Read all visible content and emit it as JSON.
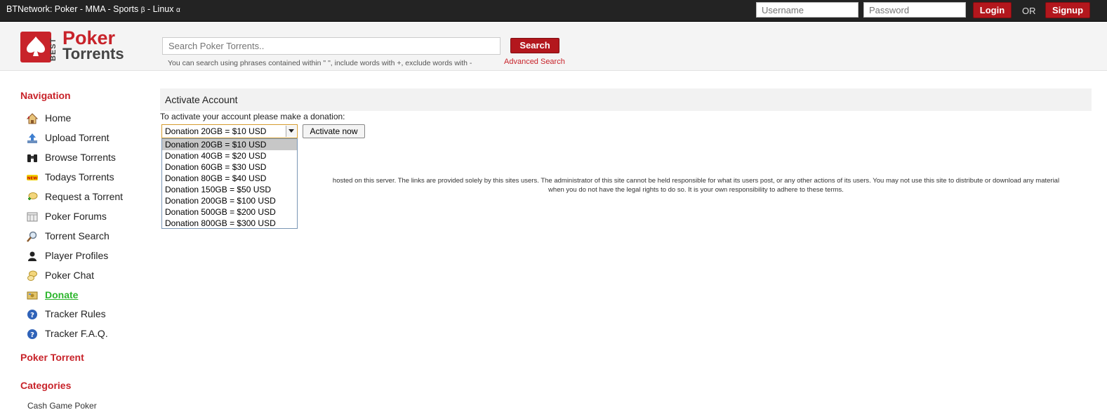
{
  "topbar": {
    "network_prefix": "BTNetwork: Poker - MMA - Sports ",
    "beta_symbol": "β",
    "network_mid": " - Linux ",
    "alpha_symbol": "α",
    "username_placeholder": "Username",
    "password_placeholder": "Password",
    "login_label": "Login",
    "or_label": "OR",
    "signup_label": "Signup"
  },
  "logo": {
    "best": "BEST",
    "poker": "Poker",
    "torrents": "Torrents"
  },
  "search": {
    "placeholder": "Search Poker Torrents..",
    "button_label": "Search",
    "hint": "You can search using phrases contained within \" \", include words with +, exclude words with -",
    "advanced_label": "Advanced Search"
  },
  "sidebar": {
    "nav_heading": "Navigation",
    "items": [
      {
        "label": "Home",
        "icon": "home-icon"
      },
      {
        "label": "Upload Torrent",
        "icon": "upload-icon"
      },
      {
        "label": "Browse Torrents",
        "icon": "binoculars-icon"
      },
      {
        "label": "Todays Torrents",
        "icon": "new-badge-icon"
      },
      {
        "label": "Request a Torrent",
        "icon": "request-icon"
      },
      {
        "label": "Poker Forums",
        "icon": "forum-icon"
      },
      {
        "label": "Torrent Search",
        "icon": "magnifier-icon"
      },
      {
        "label": "Player Profiles",
        "icon": "user-icon"
      },
      {
        "label": "Poker Chat",
        "icon": "chat-icon"
      },
      {
        "label": "Donate",
        "icon": "donate-icon"
      },
      {
        "label": "Tracker Rules",
        "icon": "help-icon"
      },
      {
        "label": "Tracker F.A.Q.",
        "icon": "help-icon"
      }
    ],
    "poker_torrent_heading": "Poker Torrent",
    "categories_heading": "Categories",
    "categories": [
      "Cash Game Poker"
    ]
  },
  "content": {
    "title": "Activate Account",
    "instruction": "To activate your account please make a donation:",
    "selected_value": "Donation 20GB = $10 USD",
    "activate_button": "Activate now",
    "options": [
      "Donation 20GB = $10 USD",
      "Donation 40GB = $20 USD",
      "Donation 60GB = $30 USD",
      "Donation 80GB = $40 USD",
      "Donation 150GB = $50 USD",
      "Donation 200GB = $100 USD",
      "Donation 500GB = $200 USD",
      "Donation 800GB = $300 USD"
    ],
    "disclaimer_line1": "hosted on this server. The links are provided solely by this sites users. The administrator of this site cannot be held responsible for what its users post, or any other actions of its users. You may not use this site to distribute or download any material",
    "disclaimer_line2": "when you do not have the legal rights to do so. It is your own responsibility to adhere to these terms."
  },
  "colors": {
    "brand_red": "#c8232a",
    "active_green": "#2db62d",
    "topbar_bg": "#232323"
  }
}
